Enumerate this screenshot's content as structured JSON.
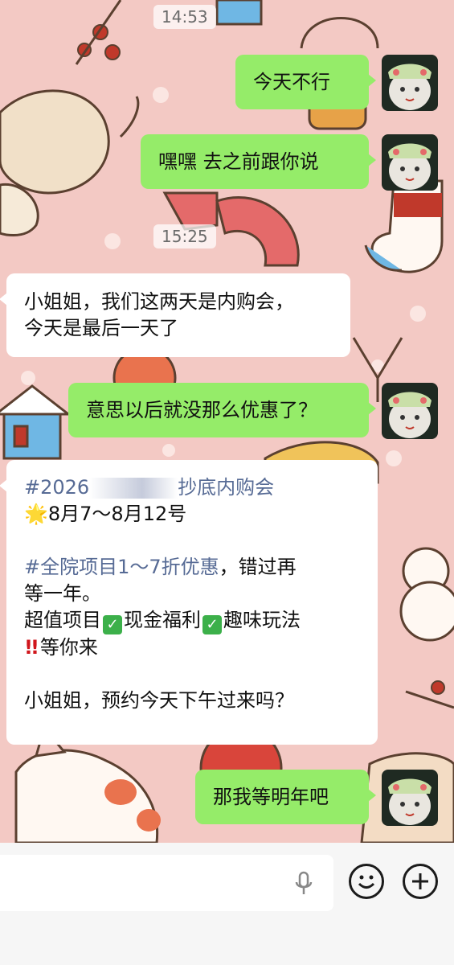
{
  "colors": {
    "background": "#f3c9c4",
    "my_bubble": "#95ec69",
    "their_bubble": "#ffffff",
    "hashtag": "#576b95"
  },
  "timestamps": [
    "14:53",
    "15:25"
  ],
  "messages": [
    {
      "from": "me",
      "text": "今天不行"
    },
    {
      "from": "me",
      "text": "嘿嘿 去之前跟你说"
    },
    {
      "from": "them",
      "line1": "小姐姐，我们这两天是内购会，",
      "line2": "今天是最后一天了"
    },
    {
      "from": "me",
      "text": "意思以后就没那么优惠了？"
    },
    {
      "from": "them",
      "hashtag1": "#2026",
      "hashtag1_tail": "抄底内购会",
      "star": "🌟",
      "dates": "8月7～8月12号",
      "hashtag2": "#全院项目1～7折优惠",
      "line3_tail": "，错过再",
      "line4": "等一年。",
      "line5_a": "超值项目",
      "line5_b": "现金福利",
      "line5_c": "趣味玩法",
      "bangs": "‼",
      "line6": "等你来",
      "line7": "小姐姐，预约今天下午过来吗？"
    },
    {
      "from": "me",
      "text": "那我等明年吧"
    }
  ],
  "input_bar": {
    "icons": [
      "microphone-icon",
      "emoji-icon",
      "plus-icon"
    ]
  }
}
